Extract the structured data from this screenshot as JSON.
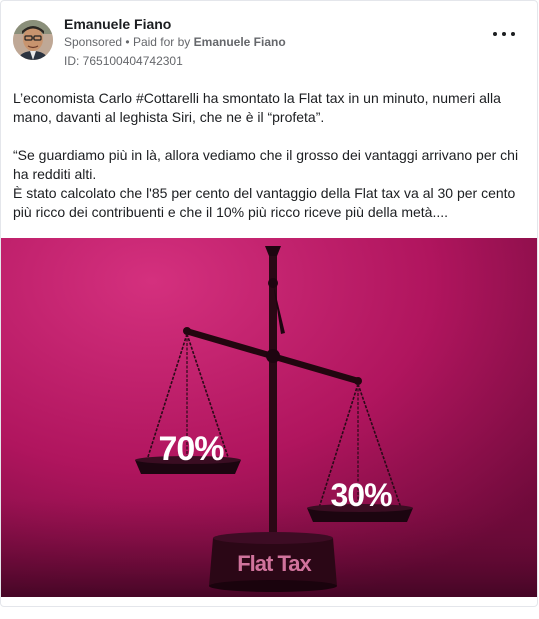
{
  "post": {
    "author": "Emanuele Fiano",
    "sponsored": "Sponsored",
    "separator": "•",
    "paid_for_prefix": "Paid for by",
    "payer": "Emanuele Fiano",
    "ad_id": "ID: 765100404742301",
    "more_icon": "more-options-icon",
    "text_lines": [
      "L’economista Carlo #Cottarelli ha smontato la Flat tax in un minuto, numeri alla",
      "mano, davanti al leghista Siri, che ne è il “profeta”.",
      "",
      "“Se guardiamo più in là, allora vediamo che il grosso dei vantaggi arrivano per chi",
      "ha redditi alti.",
      "È stato calcolato che l'85 per cento del vantaggio della Flat tax va al 30 per cento",
      "più ricco dei contribuenti e che il 10% più ricco riceve più della metà...."
    ]
  },
  "image": {
    "left_pan_label": "70%",
    "right_pan_label": "30%",
    "base_label": "Flat Tax",
    "background_color": "#b0155e"
  }
}
